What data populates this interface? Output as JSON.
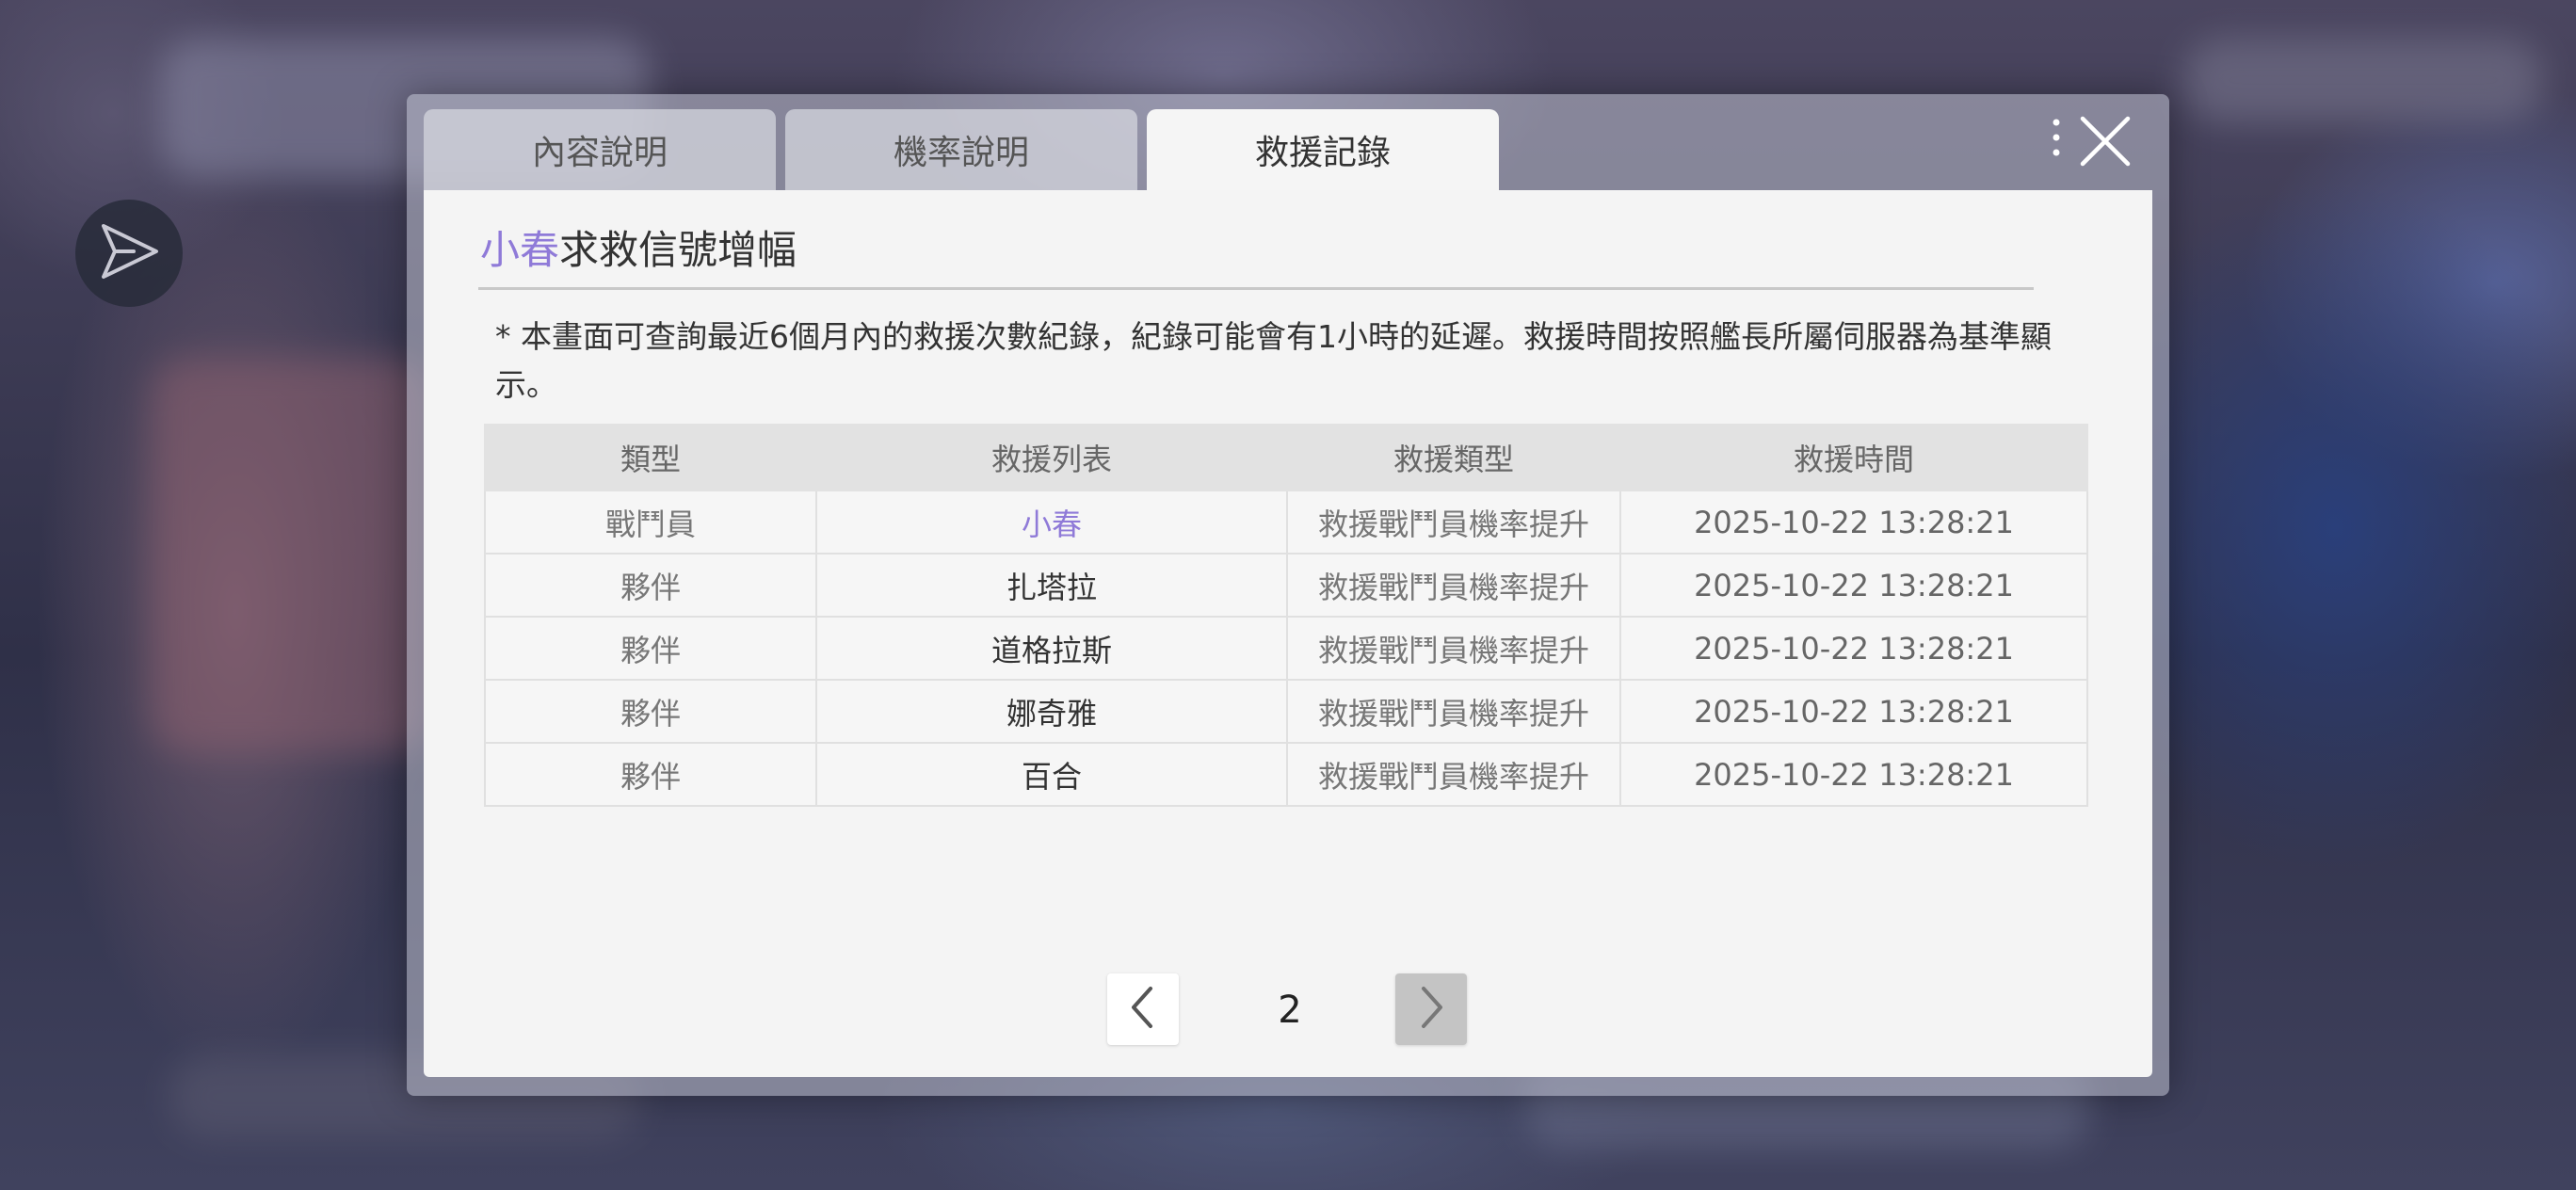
{
  "tabs": [
    {
      "label": "內容說明",
      "active": false
    },
    {
      "label": "機率說明",
      "active": false
    },
    {
      "label": "救援記錄",
      "active": true
    }
  ],
  "panel": {
    "title_highlight": "小春",
    "title_rest": "求救信號增幅",
    "notice": "* 本畫面可查詢最近6個月內的救援次數紀錄，紀錄可能會有1小時的延遲。救援時間按照艦長所屬伺服器為基準顯示。"
  },
  "table": {
    "headers": [
      "類型",
      "救援列表",
      "救援類型",
      "救援時間"
    ],
    "rows": [
      {
        "type": "戰鬥員",
        "name": "小春",
        "rescue_type": "救援戰鬥員機率提升",
        "time": "2025-10-22 13:28:21",
        "highlight": true
      },
      {
        "type": "夥伴",
        "name": "扎塔拉",
        "rescue_type": "救援戰鬥員機率提升",
        "time": "2025-10-22 13:28:21",
        "highlight": false
      },
      {
        "type": "夥伴",
        "name": "道格拉斯",
        "rescue_type": "救援戰鬥員機率提升",
        "time": "2025-10-22 13:28:21",
        "highlight": false
      },
      {
        "type": "夥伴",
        "name": "娜奇雅",
        "rescue_type": "救援戰鬥員機率提升",
        "time": "2025-10-22 13:28:21",
        "highlight": false
      },
      {
        "type": "夥伴",
        "name": "百合",
        "rescue_type": "救援戰鬥員機率提升",
        "time": "2025-10-22 13:28:21",
        "highlight": false
      }
    ]
  },
  "pagination": {
    "current_page": "2"
  },
  "colors": {
    "accent": "#8f7ad8",
    "panel_bg": "#f4f4f4",
    "header_bg": "#e2e2e2"
  },
  "icons": {
    "side_button": "paper-plane-icon",
    "close": "close-icon",
    "menu": "more-dots-icon",
    "prev": "chevron-left-icon",
    "next": "chevron-right-icon"
  }
}
